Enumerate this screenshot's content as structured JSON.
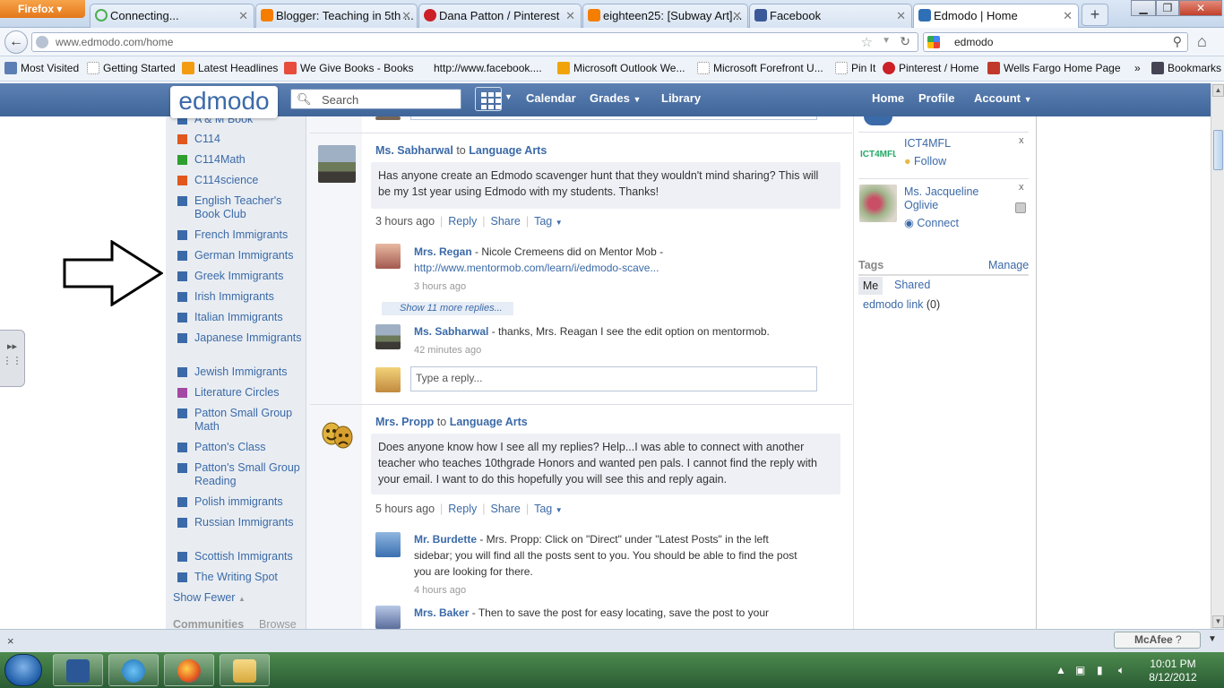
{
  "browser": {
    "button_label": "Firefox",
    "tabs": [
      {
        "label": "Connecting...",
        "icon": "spinner-icon"
      },
      {
        "label": "Blogger: Teaching in 5th ...",
        "icon": "blogger-icon"
      },
      {
        "label": "Dana Patton / Pinterest",
        "icon": "pinterest-icon"
      },
      {
        "label": "eighteen25: [Subway Art]...",
        "icon": "blogger-icon"
      },
      {
        "label": "Facebook",
        "icon": "facebook-icon"
      },
      {
        "label": "Edmodo | Home",
        "icon": "edmodo-icon"
      }
    ],
    "url": "www.edmodo.com/home",
    "search_query": "edmodo",
    "bookmarks": [
      "Most Visited",
      "Getting Started",
      "Latest Headlines",
      "We Give Books - Books",
      "http://www.facebook....",
      "Microsoft Outlook We...",
      "Microsoft Forefront U...",
      "Pin It",
      "Pinterest / Home",
      "Wells Fargo Home Page",
      "Bookmarks"
    ]
  },
  "edmodo": {
    "logo": "edmodo",
    "search_placeholder": "Search",
    "nav": {
      "calendar": "Calendar",
      "grades": "Grades",
      "library": "Library",
      "home": "Home",
      "profile": "Profile",
      "account": "Account"
    },
    "colors": {
      "header": "#4a6fa5",
      "link": "#3b6aa8"
    }
  },
  "sidebar": {
    "cut_top": "A & M Book",
    "groups": [
      {
        "name": "C114",
        "color": "#e2571e"
      },
      {
        "name": "C114Math",
        "color": "#2e9e2e"
      },
      {
        "name": "C114science",
        "color": "#e2571e"
      },
      {
        "name": "English Teacher's Book Club",
        "color": "#3b6aa8"
      },
      {
        "name": "French Immigrants",
        "color": "#3b6aa8"
      },
      {
        "name": "German Immigrants",
        "color": "#3b6aa8"
      },
      {
        "name": "Greek Immigrants",
        "color": "#3b6aa8"
      },
      {
        "name": "Irish Immigrants",
        "color": "#3b6aa8"
      },
      {
        "name": "Italian Immigrants",
        "color": "#3b6aa8"
      },
      {
        "name": "Japanese Immigrants",
        "color": "#3b6aa8"
      },
      {
        "name": "Jewish Immigrants",
        "color": "#3b6aa8"
      },
      {
        "name": "Literature Circles",
        "color": "#a349a4"
      },
      {
        "name": "Patton Small Group Math",
        "color": "#3b6aa8"
      },
      {
        "name": "Patton's Class",
        "color": "#3b6aa8"
      },
      {
        "name": "Patton's Small Group Reading",
        "color": "#3b6aa8"
      },
      {
        "name": "Polish immigrants",
        "color": "#3b6aa8"
      },
      {
        "name": "Russian Immigrants",
        "color": "#3b6aa8"
      },
      {
        "name": "Scottish Immigrants",
        "color": "#3b6aa8"
      },
      {
        "name": "The Writing Spot",
        "color": "#3b6aa8"
      }
    ],
    "show_fewer": "Show Fewer",
    "communities": "Communities",
    "browse": "Browse"
  },
  "posts": [
    {
      "author": "Ms. Sabharwal",
      "to_word": "to",
      "group": "Language Arts",
      "body": "Has anyone create an Edmodo scavenger hunt that they wouldn't mind sharing? This will be my 1st year using Edmodo with my students. Thanks!",
      "time": "3 hours ago",
      "reply": "Reply",
      "share": "Share",
      "tag": "Tag",
      "replies": [
        {
          "author": "Mrs. Regan",
          "text": " - Nicole Cremeens did on Mentor Mob - ",
          "link": "http://www.mentormob.com/learn/i/edmodo-scave...",
          "time": "3 hours ago"
        },
        {
          "author": "Ms. Sabharwal",
          "text": " - thanks, Mrs. Reagan I see the edit option on mentormob.",
          "time": "42 minutes ago"
        }
      ],
      "show_more": "Show 11 more replies...",
      "reply_placeholder": "Type a reply..."
    },
    {
      "author": "Mrs. Propp",
      "to_word": "to",
      "group": "Language Arts",
      "body": "Does anyone know how I see all my replies? Help...I was able to connect with another teacher who teaches 10thgrade Honors and wanted pen pals. I cannot find the reply with your email. I want to do this hopefully you will see this and reply again.",
      "time": "5 hours ago",
      "reply": "Reply",
      "share": "Share",
      "tag": "Tag",
      "replies": [
        {
          "author": "Mr. Burdette",
          "text": " - Mrs. Propp: Click on \"Direct\" under \"Latest Posts\" in the left sidebar; you will find all the posts sent to you. You should be able to find the post you are looking for there.",
          "time": "4 hours ago"
        },
        {
          "author": "Mrs. Baker",
          "text": " - Then to save the post for easy locating, save the post to your"
        }
      ]
    }
  ],
  "right": {
    "suggestions": [
      {
        "name": "ICT4MFL",
        "action": "Follow",
        "close": "x"
      },
      {
        "name": "Ms. Jacqueline Oglivie",
        "action": "Connect",
        "close": "x"
      }
    ],
    "tags_title": "Tags",
    "manage": "Manage",
    "tab_me": "Me",
    "tab_shared": "Shared",
    "tag_name": "edmodo link",
    "tag_count": "(0)"
  },
  "status": {
    "close": "×",
    "mcafee": "McAfee"
  },
  "taskbar": {
    "time": "10:01 PM",
    "date": "8/12/2012"
  }
}
